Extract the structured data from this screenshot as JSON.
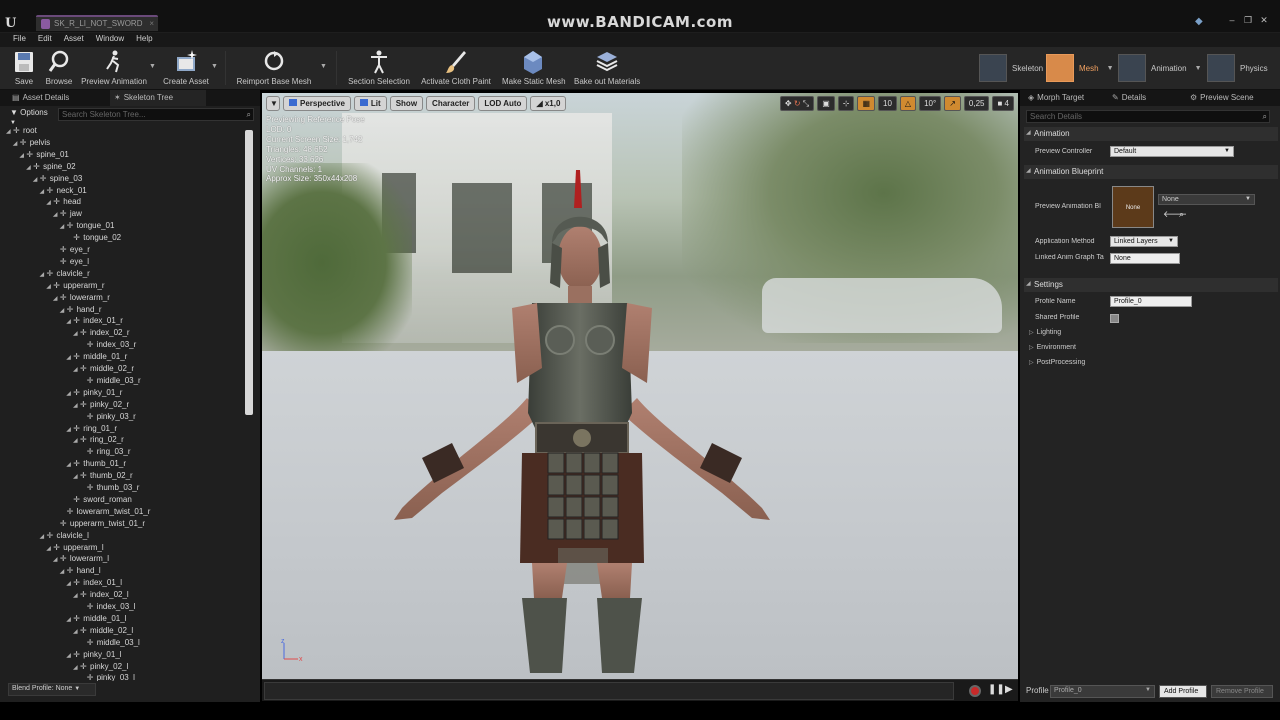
{
  "window": {
    "tab_title": "SK_R_LI_NOT_SWORD",
    "watermark": "www.BANDICAM.com"
  },
  "menu": [
    "File",
    "Edit",
    "Asset",
    "Window",
    "Help"
  ],
  "toolbar": {
    "save": "Save",
    "browse": "Browse",
    "preview_animation": "Preview Animation",
    "create_asset": "Create Asset",
    "reimport": "Reimport Base Mesh",
    "section_selection": "Section Selection",
    "activate_cloth": "Activate Cloth Paint",
    "make_static": "Make Static Mesh",
    "bake_materials": "Bake out Materials"
  },
  "modes": {
    "skeleton": "Skeleton",
    "mesh": "Mesh",
    "animation": "Animation",
    "physics": "Physics"
  },
  "left_panel": {
    "tab_asset_details": "Asset Details",
    "tab_skeleton_tree": "Skeleton Tree",
    "options": "Options",
    "search_placeholder": "Search Skeleton Tree...",
    "blend_profile": "Blend Profile: None",
    "bones": [
      {
        "name": "root",
        "d": 0,
        "exp": true
      },
      {
        "name": "pelvis",
        "d": 1,
        "exp": true
      },
      {
        "name": "spine_01",
        "d": 2,
        "exp": true
      },
      {
        "name": "spine_02",
        "d": 3,
        "exp": true
      },
      {
        "name": "spine_03",
        "d": 4,
        "exp": true
      },
      {
        "name": "neck_01",
        "d": 5,
        "exp": true
      },
      {
        "name": "head",
        "d": 6,
        "exp": true
      },
      {
        "name": "jaw",
        "d": 7,
        "exp": true
      },
      {
        "name": "tongue_01",
        "d": 8,
        "exp": true
      },
      {
        "name": "tongue_02",
        "d": 9,
        "exp": false
      },
      {
        "name": "eye_r",
        "d": 7,
        "exp": false
      },
      {
        "name": "eye_l",
        "d": 7,
        "exp": false
      },
      {
        "name": "clavicle_r",
        "d": 5,
        "exp": true
      },
      {
        "name": "upperarm_r",
        "d": 6,
        "exp": true
      },
      {
        "name": "lowerarm_r",
        "d": 7,
        "exp": true
      },
      {
        "name": "hand_r",
        "d": 8,
        "exp": true
      },
      {
        "name": "index_01_r",
        "d": 9,
        "exp": true
      },
      {
        "name": "index_02_r",
        "d": 10,
        "exp": true
      },
      {
        "name": "index_03_r",
        "d": 11,
        "exp": false
      },
      {
        "name": "middle_01_r",
        "d": 9,
        "exp": true
      },
      {
        "name": "middle_02_r",
        "d": 10,
        "exp": true
      },
      {
        "name": "middle_03_r",
        "d": 11,
        "exp": false
      },
      {
        "name": "pinky_01_r",
        "d": 9,
        "exp": true
      },
      {
        "name": "pinky_02_r",
        "d": 10,
        "exp": true
      },
      {
        "name": "pinky_03_r",
        "d": 11,
        "exp": false
      },
      {
        "name": "ring_01_r",
        "d": 9,
        "exp": true
      },
      {
        "name": "ring_02_r",
        "d": 10,
        "exp": true
      },
      {
        "name": "ring_03_r",
        "d": 11,
        "exp": false
      },
      {
        "name": "thumb_01_r",
        "d": 9,
        "exp": true
      },
      {
        "name": "thumb_02_r",
        "d": 10,
        "exp": true
      },
      {
        "name": "thumb_03_r",
        "d": 11,
        "exp": false
      },
      {
        "name": "sword_roman",
        "d": 9,
        "exp": false
      },
      {
        "name": "lowerarm_twist_01_r",
        "d": 8,
        "exp": false
      },
      {
        "name": "upperarm_twist_01_r",
        "d": 7,
        "exp": false
      },
      {
        "name": "clavicle_l",
        "d": 5,
        "exp": true
      },
      {
        "name": "upperarm_l",
        "d": 6,
        "exp": true
      },
      {
        "name": "lowerarm_l",
        "d": 7,
        "exp": true
      },
      {
        "name": "hand_l",
        "d": 8,
        "exp": true
      },
      {
        "name": "index_01_l",
        "d": 9,
        "exp": true
      },
      {
        "name": "index_02_l",
        "d": 10,
        "exp": true
      },
      {
        "name": "index_03_l",
        "d": 11,
        "exp": false
      },
      {
        "name": "middle_01_l",
        "d": 9,
        "exp": true
      },
      {
        "name": "middle_02_l",
        "d": 10,
        "exp": true
      },
      {
        "name": "middle_03_l",
        "d": 11,
        "exp": false
      },
      {
        "name": "pinky_01_l",
        "d": 9,
        "exp": true
      },
      {
        "name": "pinky_02_l",
        "d": 10,
        "exp": true
      },
      {
        "name": "pinky_03_l",
        "d": 11,
        "exp": false
      }
    ]
  },
  "viewport": {
    "perspective": "Perspective",
    "lit": "Lit",
    "show": "Show",
    "character": "Character",
    "lod": "LOD Auto",
    "speed": "x1,0",
    "grid_snap": "10",
    "rot_snap": "10°",
    "scale_snap": "0,25",
    "cam_speed": "4",
    "stats": [
      "Previewing Reference Pose",
      "LOD: 0",
      "Current Screen Size: 1,742",
      "Triangles: 48 652",
      "Vertices: 33 626",
      "UV Channels: 1",
      "Approx Size: 350x44x208"
    ]
  },
  "right_panel": {
    "tab_morph": "Morph Target",
    "tab_details": "Details",
    "tab_preview": "Preview Scene",
    "search_placeholder": "Search Details",
    "sec_animation": "Animation",
    "preview_controller_label": "Preview Controller",
    "preview_controller_value": "Default",
    "sec_anim_bp": "Animation Blueprint",
    "preview_anim_bp_label": "Preview Animation Bl",
    "anim_bp_thumb": "None",
    "anim_bp_value": "None",
    "app_method_label": "Application Method",
    "app_method_value": "Linked Layers",
    "linked_graph_label": "Linked Anim Graph Ta",
    "linked_graph_value": "None",
    "sec_settings": "Settings",
    "profile_name_label": "Profile Name",
    "profile_name_value": "Profile_0",
    "shared_profile_label": "Shared Profile",
    "lighting": "Lighting",
    "environment": "Environment",
    "postprocessing": "PostProcessing",
    "profile_label": "Profile",
    "profile_value": "Profile_0",
    "add_profile": "Add Profile",
    "remove_profile": "Remove Profile"
  }
}
